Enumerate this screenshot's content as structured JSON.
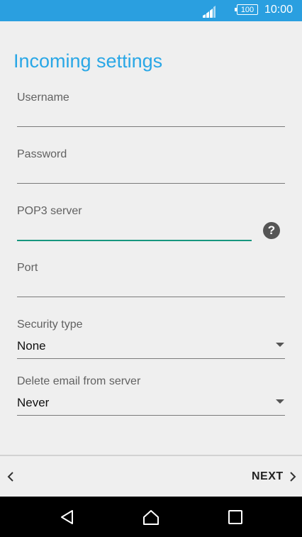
{
  "status_bar": {
    "battery": "100",
    "time": "10:00"
  },
  "page": {
    "title": "Incoming settings"
  },
  "form": {
    "username": {
      "label": "Username",
      "value": ""
    },
    "password": {
      "label": "Password",
      "value": ""
    },
    "pop3_server": {
      "label": "POP3 server",
      "value": "",
      "help_icon": "help-icon"
    },
    "port": {
      "label": "Port",
      "value": ""
    },
    "security_type": {
      "label": "Security type",
      "value": "None"
    },
    "delete_email": {
      "label": "Delete email from server",
      "value": "Never"
    }
  },
  "footer": {
    "next_label": "NEXT"
  },
  "colors": {
    "status_bar": "#2a9fe0",
    "title": "#29a7e6",
    "accent_line": "#17967f",
    "background": "#efefef"
  }
}
